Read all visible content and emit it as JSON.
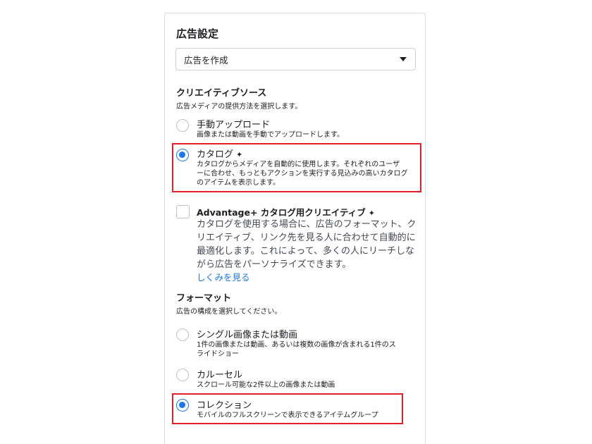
{
  "panel": {
    "title": "広告設定",
    "dropdown": {
      "value": "広告を作成",
      "icon": "caret-down-icon"
    }
  },
  "creative_source": {
    "title": "クリエイティブソース",
    "subtitle": "広告メディアの提供方法を選択します。",
    "options": [
      {
        "label": "手動アップロード",
        "description": "画像または動画を手動でアップロードします。",
        "selected": false
      },
      {
        "label": "カタログ",
        "description_lines": [
          "カタログからメディアを自動的に使用します。それぞれのユーザ",
          "ーに合わせ、もっともアクションを実行する見込みの高いカタログ",
          "のアイテムを表示します。"
        ],
        "selected": true,
        "icon": "sparkle-icon"
      }
    ]
  },
  "advantage": {
    "label": "Advantage+ カタログ用クリエイティブ",
    "icon": "sparkle-icon",
    "description_lines": [
      "カタログを使用する場合に、広告のフォーマット、ク",
      "リエイティブ、リンク先を見る人に合わせて自動的に",
      "最適化します。これによって、多くの人にリーチしな",
      "がら広告をパーソナライズできます。"
    ],
    "link": "しくみを見る",
    "checked": false
  },
  "format": {
    "title": "フォーマット",
    "subtitle": "広告の構成を選択してください。",
    "options": [
      {
        "label": "シングル画像または動画",
        "description_lines": [
          "1件の画像または動画、あるいは複数の画像が含まれる1件のス",
          "ライドショー"
        ],
        "selected": false
      },
      {
        "label": "カルーセル",
        "description": "スクロール可能な2件以上の画像または動画",
        "selected": false
      },
      {
        "label": "コレクション",
        "description": "モバイルのフルスクリーンで表示できるアイテムグループ",
        "selected": true
      }
    ]
  },
  "colors": {
    "accent": "#1877f2",
    "highlight_box": "#e3202a",
    "border": "#dadde1"
  }
}
